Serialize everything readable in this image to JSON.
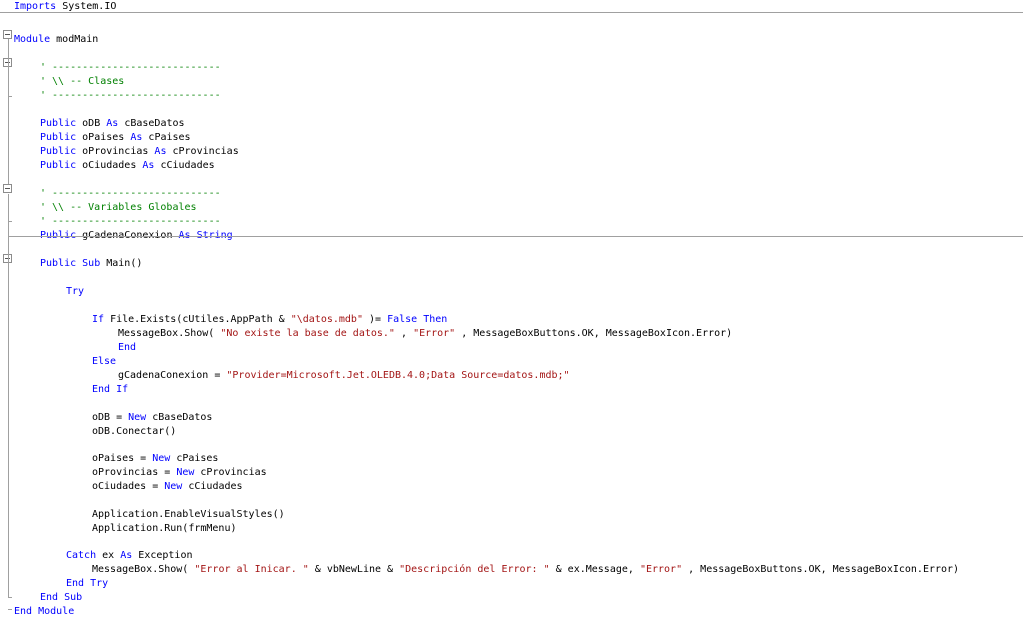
{
  "editor": {
    "lines": [
      [
        [
          "kw",
          "Imports"
        ],
        [
          "",
          "System.IO"
        ]
      ],
      [],
      [
        [
          "kw",
          "Module"
        ],
        [
          "",
          "modMain"
        ]
      ],
      [],
      [
        [
          "cm",
          "' ----------------------------"
        ]
      ],
      [
        [
          "cm",
          "' \\\\ -- Clases"
        ]
      ],
      [
        [
          "cm",
          "' ----------------------------"
        ]
      ],
      [],
      [
        [
          "kw",
          "Public"
        ],
        [
          "",
          "oDB"
        ],
        [
          "kw",
          "As"
        ],
        [
          "",
          "cBaseDatos"
        ]
      ],
      [
        [
          "kw",
          "Public"
        ],
        [
          "",
          "oPaises"
        ],
        [
          "kw",
          "As"
        ],
        [
          "",
          "cPaises"
        ]
      ],
      [
        [
          "kw",
          "Public"
        ],
        [
          "",
          "oProvincias"
        ],
        [
          "kw",
          "As"
        ],
        [
          "",
          "cProvincias"
        ]
      ],
      [
        [
          "kw",
          "Public"
        ],
        [
          "",
          "oCiudades"
        ],
        [
          "kw",
          "As"
        ],
        [
          "",
          "cCiudades"
        ]
      ],
      [],
      [
        [
          "cm",
          "' ----------------------------"
        ]
      ],
      [
        [
          "cm",
          "' \\\\ -- Variables Globales"
        ]
      ],
      [
        [
          "cm",
          "' ----------------------------"
        ]
      ],
      [
        [
          "kw",
          "Public"
        ],
        [
          "",
          "gCadenaConexion"
        ],
        [
          "kw",
          "As"
        ],
        [
          "kw",
          "String"
        ]
      ],
      [],
      [
        [
          "kw",
          "Public"
        ],
        [
          "kw",
          "Sub"
        ],
        [
          "",
          "Main()"
        ]
      ],
      [],
      [
        [
          "kw",
          "Try"
        ]
      ],
      [],
      [
        [
          "kw",
          "If"
        ],
        [
          "",
          "File.Exists(cUtiles.AppPath &"
        ],
        [
          "str",
          "\"\\datos.mdb\""
        ],
        [
          "",
          ")="
        ],
        [
          "kw",
          "False"
        ],
        [
          "kw",
          "Then"
        ]
      ],
      [
        [
          "",
          "MessageBox.Show("
        ],
        [
          "str",
          "\"No existe la base de datos.\""
        ],
        [
          "",
          ","
        ],
        [
          "str",
          "\"Error\""
        ],
        [
          "",
          ", MessageBoxButtons.OK, MessageBoxIcon.Error)"
        ]
      ],
      [
        [
          "kw",
          "End"
        ]
      ],
      [
        [
          "kw",
          "Else"
        ]
      ],
      [
        [
          "",
          "gCadenaConexion ="
        ],
        [
          "str",
          "\"Provider=Microsoft.Jet.OLEDB.4.0;Data Source=datos.mdb;\""
        ]
      ],
      [
        [
          "kw",
          "End"
        ],
        [
          "kw",
          "If"
        ]
      ],
      [],
      [
        [
          "",
          "oDB ="
        ],
        [
          "kw",
          "New"
        ],
        [
          "",
          "cBaseDatos"
        ]
      ],
      [
        [
          "",
          "oDB.Conectar()"
        ]
      ],
      [],
      [
        [
          "",
          "oPaises ="
        ],
        [
          "kw",
          "New"
        ],
        [
          "",
          "cPaises"
        ]
      ],
      [
        [
          "",
          "oProvincias ="
        ],
        [
          "kw",
          "New"
        ],
        [
          "",
          "cProvincias"
        ]
      ],
      [
        [
          "",
          "oCiudades ="
        ],
        [
          "kw",
          "New"
        ],
        [
          "",
          "cCiudades"
        ]
      ],
      [],
      [
        [
          "",
          "Application.EnableVisualStyles()"
        ]
      ],
      [
        [
          "",
          "Application.Run(frmMenu)"
        ]
      ],
      [],
      [
        [
          "kw",
          "Catch"
        ],
        [
          "",
          "ex"
        ],
        [
          "kw",
          "As"
        ],
        [
          "",
          "Exception"
        ]
      ],
      [
        [
          "",
          "MessageBox.Show("
        ],
        [
          "str",
          "\"Error al Inicar. \""
        ],
        [
          "",
          "& vbNewLine &"
        ],
        [
          "str",
          "\"Descripción del Error: \""
        ],
        [
          "",
          "& ex.Message,"
        ],
        [
          "str",
          "\"Error\""
        ],
        [
          "",
          ", MessageBoxButtons.OK, MessageBoxIcon.Error)"
        ]
      ],
      [
        [
          "kw",
          "End"
        ],
        [
          "kw",
          "Try"
        ]
      ],
      [
        [
          "kw",
          "End"
        ],
        [
          "kw",
          "Sub"
        ]
      ],
      [
        [
          "kw",
          "End"
        ],
        [
          "kw",
          "Module"
        ]
      ]
    ]
  }
}
